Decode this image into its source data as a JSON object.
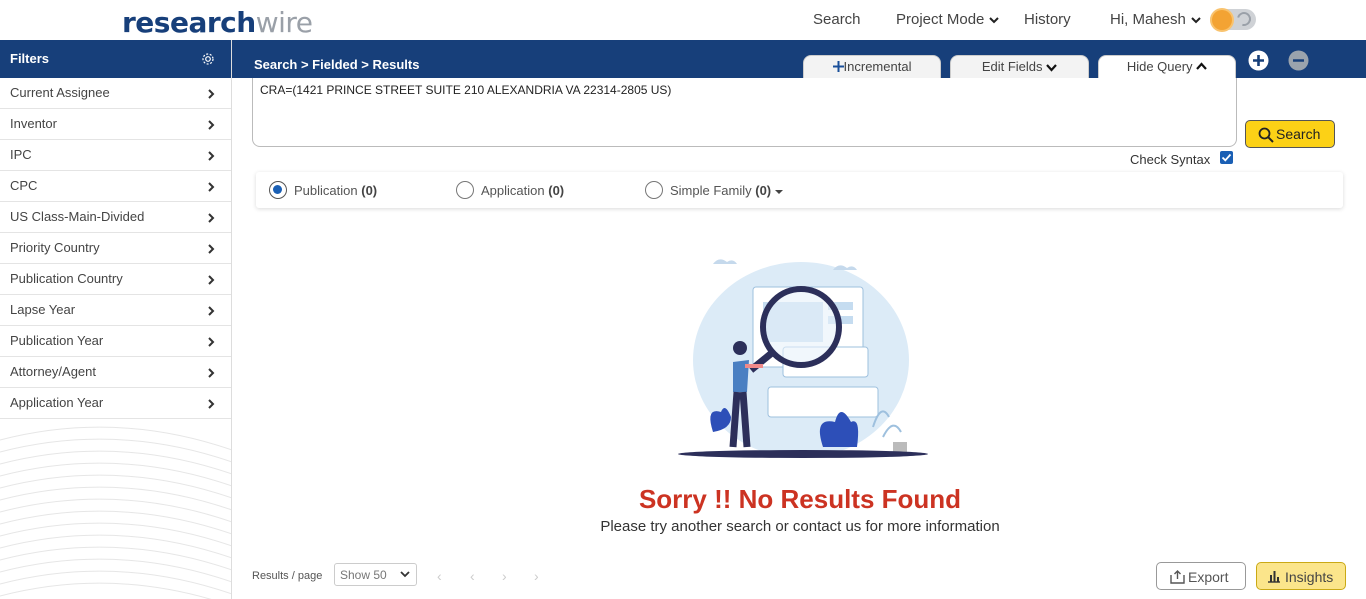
{
  "header": {
    "logo_part1": "research",
    "logo_part2": "wire",
    "nav": {
      "search": "Search",
      "project_mode": "Project Mode",
      "history": "History",
      "user": "Hi, Mahesh"
    }
  },
  "sidebar": {
    "title": "Filters",
    "items": [
      {
        "label": "Current Assignee"
      },
      {
        "label": "Inventor"
      },
      {
        "label": "IPC"
      },
      {
        "label": "CPC"
      },
      {
        "label": "US Class-Main-Divided"
      },
      {
        "label": "Priority Country"
      },
      {
        "label": "Publication Country"
      },
      {
        "label": "Lapse Year"
      },
      {
        "label": "Publication Year"
      },
      {
        "label": "Attorney/Agent"
      },
      {
        "label": "Application Year"
      }
    ]
  },
  "breadcrumb": "Search > Fielded > Results",
  "tabs": {
    "incremental": "Incremental",
    "edit_fields": "Edit Fields",
    "hide_query": "Hide Query"
  },
  "query": {
    "text": "CRA=(1421 PRINCE STREET SUITE 210 ALEXANDRIA VA 22314-2805 US)"
  },
  "search_button": "Search",
  "check_syntax": {
    "label": "Check Syntax",
    "checked": true
  },
  "result_tabs": [
    {
      "label": "Publication",
      "count": "(0)",
      "selected": true
    },
    {
      "label": "Application",
      "count": "(0)",
      "selected": false
    },
    {
      "label": "Simple Family",
      "count": "(0)",
      "selected": false
    }
  ],
  "empty": {
    "title": "Sorry !! No Results Found",
    "message": "Please try another search or contact us for more information"
  },
  "footer": {
    "results_per_page_label": "Results / page",
    "page_size": "Show 50",
    "export": "Export",
    "insights": "Insights"
  },
  "colors": {
    "brand_navy": "#173f7a",
    "accent_yellow": "#fcd116",
    "error_red": "#cc3322"
  }
}
